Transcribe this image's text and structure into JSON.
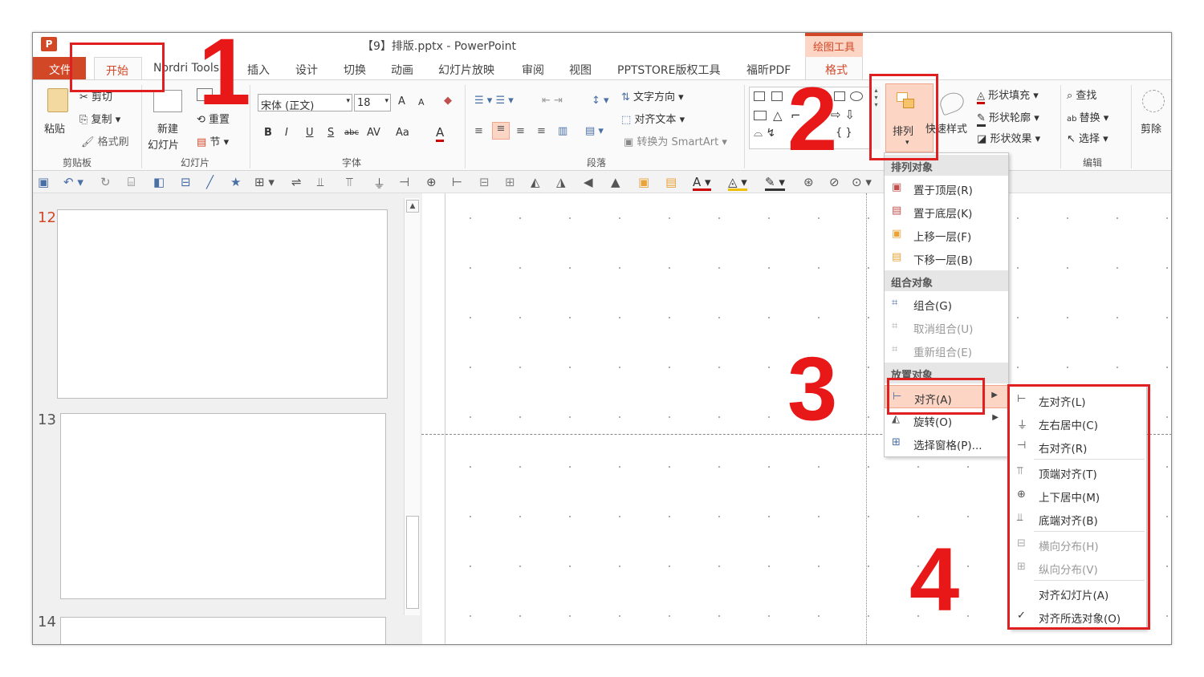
{
  "app_icon": "P",
  "title": "【9】排版.pptx - PowerPoint",
  "drawing_tools": "绘图工具",
  "tabs": [
    "文件",
    "开始",
    "Nordri Tools",
    "插入",
    "设计",
    "切换",
    "动画",
    "幻灯片放映",
    "审阅",
    "视图",
    "PPTSTORE版权工具",
    "福昕PDF",
    "格式"
  ],
  "clipboard": {
    "paste": "粘贴",
    "cut": "剪切",
    "copy": "复制",
    "format_painter": "格式刷",
    "label": "剪贴板"
  },
  "slides_group": {
    "new_slide_1": "新建",
    "new_slide_2": "幻灯片",
    "reset": "重置",
    "section": "节",
    "label": "幻灯片"
  },
  "font": {
    "name": "宋体 (正文)",
    "size": "18",
    "grow": "A",
    "shrink": "A",
    "bold": "B",
    "italic": "I",
    "underline": "U",
    "strike": "S",
    "abc": "abc",
    "spacing": "AV",
    "case": "Aa",
    "color": "A",
    "label": "字体"
  },
  "paragraph": {
    "text_direction": "文字方向",
    "align_text": "对齐文本",
    "smartart": "转换为 SmartArt",
    "label": "段落"
  },
  "drawing": {
    "arrange": "排列",
    "quick_styles": "快速样式",
    "fill": "形状填充",
    "outline": "形状轮廓",
    "effects": "形状效果"
  },
  "editing": {
    "find": "查找",
    "replace": "替换",
    "select": "选择",
    "label": "编辑",
    "crop": "剪除"
  },
  "slide_numbers": [
    "12",
    "13",
    "14"
  ],
  "arrange_menu": {
    "header1": "排列对象",
    "items1": [
      "置于顶层(R)",
      "置于底层(K)",
      "上移一层(F)",
      "下移一层(B)"
    ],
    "header2": "组合对象",
    "items2": [
      "组合(G)",
      "取消组合(U)",
      "重新组合(E)"
    ],
    "header3": "放置对象",
    "items3": [
      "对齐(A)",
      "旋转(O)",
      "选择窗格(P)..."
    ]
  },
  "align_menu": {
    "items": [
      "左对齐(L)",
      "左右居中(C)",
      "右对齐(R)",
      "顶端对齐(T)",
      "上下居中(M)",
      "底端对齐(B)",
      "横向分布(H)",
      "纵向分布(V)",
      "对齐幻灯片(A)",
      "对齐所选对象(O)"
    ],
    "check": "✓"
  },
  "annotations": [
    "1",
    "2",
    "3",
    "4"
  ],
  "colors": {
    "accent": "#d24726",
    "annotation": "#e81818",
    "hover": "#fcd5c5"
  }
}
